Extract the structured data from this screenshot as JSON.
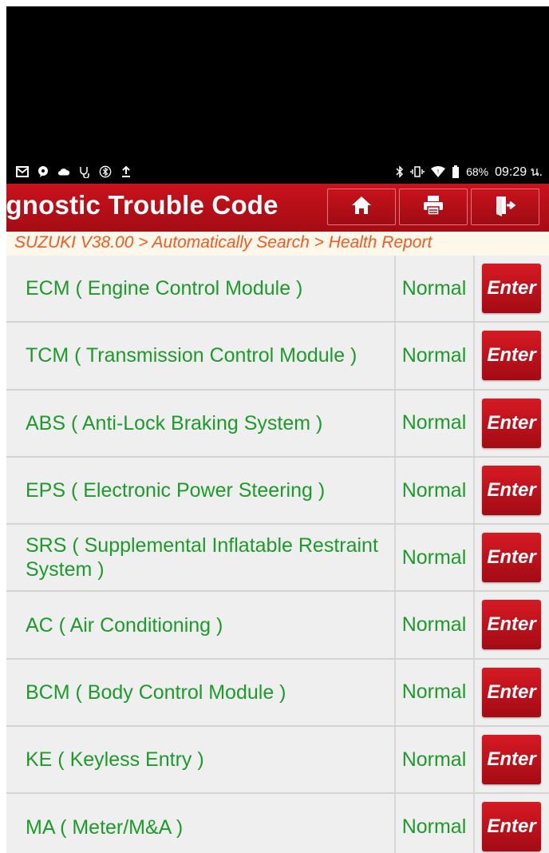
{
  "status_bar": {
    "left_icons": [
      "gmail-icon",
      "chat-icon",
      "cloud-icon",
      "stethoscope-icon",
      "bluetooth-circle-icon",
      "upload-icon"
    ],
    "right_icons": [
      "bluetooth-icon",
      "vibrate-icon",
      "wifi-icon",
      "battery-icon"
    ],
    "battery": "68%",
    "time": "09:29 น."
  },
  "header": {
    "title": "ıgnostic Trouble Code",
    "buttons": [
      "home-icon",
      "printer-icon",
      "exit-icon"
    ]
  },
  "breadcrumb": "SUZUKI V38.00 > Automatically Search > Health Report",
  "modules": [
    {
      "name": "ECM ( Engine Control Module )",
      "status": "Normal",
      "action": "Enter"
    },
    {
      "name": "TCM ( Transmission Control Module )",
      "status": "Normal",
      "action": "Enter"
    },
    {
      "name": "ABS ( Anti-Lock Braking System )",
      "status": "Normal",
      "action": "Enter"
    },
    {
      "name": "EPS ( Electronic Power Steering )",
      "status": "Normal",
      "action": "Enter"
    },
    {
      "name": "SRS ( Supplemental Inflatable Restraint System )",
      "status": "Normal",
      "action": "Enter"
    },
    {
      "name": "AC ( Air Conditioning )",
      "status": "Normal",
      "action": "Enter"
    },
    {
      "name": "BCM ( Body Control Module )",
      "status": "Normal",
      "action": "Enter"
    },
    {
      "name": "KE ( Keyless Entry )",
      "status": "Normal",
      "action": "Enter"
    },
    {
      "name": "MA ( Meter/M&A )",
      "status": "Normal",
      "action": "Enter"
    }
  ],
  "colors": {
    "header_red": "#c8121c",
    "text_green": "#1d9b2a",
    "breadcrumb_orange": "#f15a24",
    "row_bg": "#efefef"
  }
}
